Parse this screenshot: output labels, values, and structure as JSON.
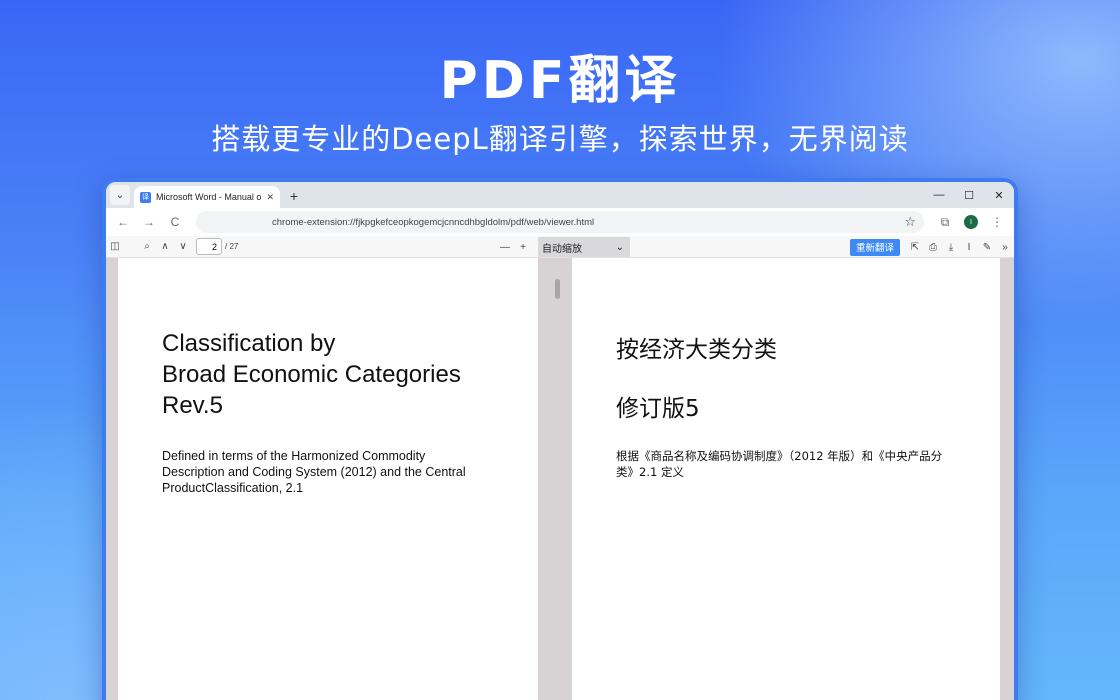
{
  "hero": {
    "title": "PDF翻译",
    "subtitle": "搭载更专业的DeepL翻译引擎，探索世界，无界阅读"
  },
  "browser": {
    "tab_menu_glyph": "⌄",
    "tab": {
      "favicon_label": "译",
      "title": "Microsoft Word - Manual of BEC",
      "close_glyph": "✕"
    },
    "new_tab_glyph": "+",
    "window_controls": {
      "minimize": "—",
      "maximize": "☐",
      "close": "✕"
    },
    "nav": {
      "back": "←",
      "forward": "→",
      "reload": "C"
    },
    "address": "chrome-extension://fjkpgkefceopkogemcjcnncdhbgldolm/pdf/web/viewer.html",
    "star_glyph": "☆",
    "extensions_glyph": "⧉",
    "profile_initial": "I",
    "menu_glyph": "⋮"
  },
  "pdf_toolbar": {
    "sidebar_glyph": "◫",
    "search_glyph": "⌕",
    "prev_glyph": "∧",
    "next_glyph": "∨",
    "page_current": "2",
    "page_total": "/ 27",
    "zoom_out_glyph": "—",
    "zoom_in_glyph": "+",
    "zoom_value": "自动缩放",
    "zoom_caret": "⌄",
    "retranslate_label": "重新翻译",
    "open_glyph": "⇱",
    "print_glyph": "⎙",
    "download_glyph": "⤓",
    "text_glyph": "I",
    "draw_glyph": "✎",
    "more_glyph": "»"
  },
  "original_page": {
    "title_line1": "Classification by",
    "title_line2": "Broad Economic Categories",
    "title_line3": "Rev.5",
    "body_line1": "Defined in terms of the Harmonized Commodity",
    "body_line2": "Description and Coding System (2012) and the Central",
    "body_line3": "ProductClassification, 2.1"
  },
  "translated_page": {
    "title": "按经济大类分类",
    "subtitle": "修订版5",
    "body_line1": "根据《商品名称及编码协调制度》（2012 年版）和《中央产品分",
    "body_line2": "类》2.1 定义"
  }
}
